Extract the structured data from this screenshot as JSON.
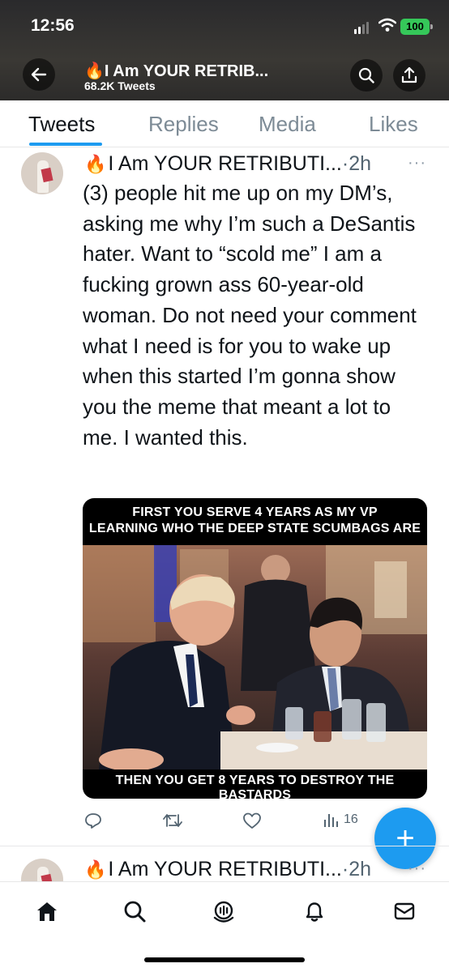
{
  "status_bar": {
    "time": "12:56",
    "battery": "100"
  },
  "header": {
    "title_emoji": "🔥",
    "title": "I Am YOUR RETRIB...",
    "subtitle": "68.2K Tweets"
  },
  "tabs": [
    {
      "label": "Tweets",
      "active": true
    },
    {
      "label": "Replies",
      "active": false
    },
    {
      "label": "Media",
      "active": false
    },
    {
      "label": "Likes",
      "active": false
    }
  ],
  "tweets": [
    {
      "emoji": "🔥",
      "name": "I Am YOUR RETRIBUTI...",
      "time": "·2h",
      "more": "···",
      "text": "(3) people hit me up on my DM’s, asking me why I’m such a DeSantis hater. Want to “scold me” I am a fucking grown ass 60-year-old woman. Do not need your comment what I need is for you to wake up when this started I’m gonna show you the meme that meant a lot to me. I wanted this.",
      "image": {
        "top_caption_line1": "FIRST YOU SERVE 4 YEARS AS MY VP",
        "top_caption_line2": "LEARNING WHO THE DEEP STATE SCUMBAGS ARE",
        "bottom_caption": "THEN YOU GET 8 YEARS TO DESTROY THE BASTARDS"
      },
      "actions": {
        "reply_icon": "reply-icon",
        "retweet_icon": "retweet-icon",
        "like_icon": "like-icon",
        "views_icon": "views-icon",
        "views_count": "16"
      }
    },
    {
      "emoji": "🔥",
      "name": "I Am YOUR RETRIBUTI...",
      "time": "·2h",
      "more": "···"
    }
  ],
  "fab": {
    "label": "+"
  },
  "bottom_nav": [
    "home-icon",
    "search-icon",
    "spaces-icon",
    "notifications-icon",
    "messages-icon"
  ],
  "colors": {
    "accent": "#1d9bf0",
    "text": "#0f1419",
    "secondary": "#536471"
  }
}
